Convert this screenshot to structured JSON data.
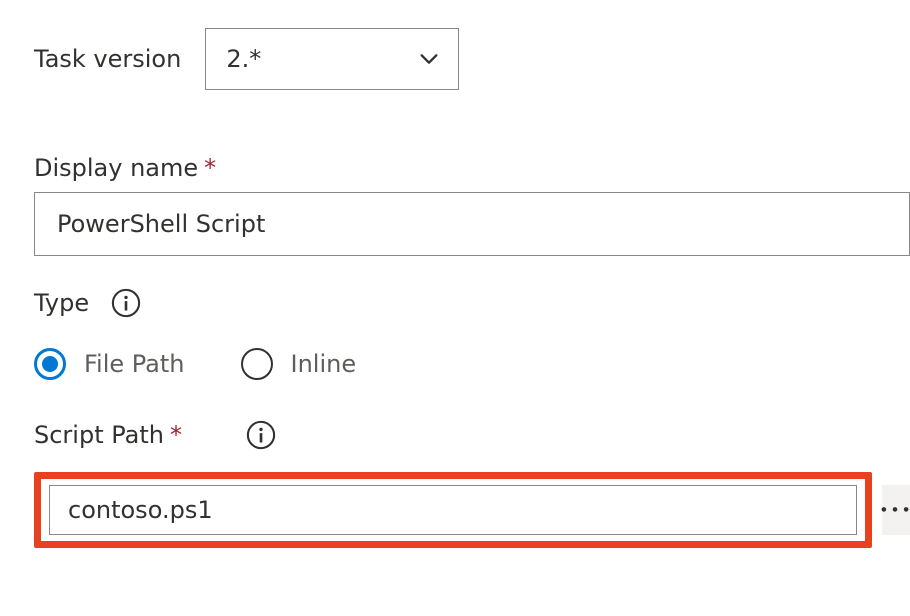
{
  "taskVersion": {
    "label": "Task version",
    "value": "2.*"
  },
  "displayName": {
    "label": "Display name",
    "value": "PowerShell Script"
  },
  "type": {
    "label": "Type",
    "options": {
      "filePath": "File Path",
      "inline": "Inline"
    },
    "selected": "filePath"
  },
  "scriptPath": {
    "label": "Script Path",
    "value": "contoso.ps1"
  },
  "ellipsis": "…"
}
